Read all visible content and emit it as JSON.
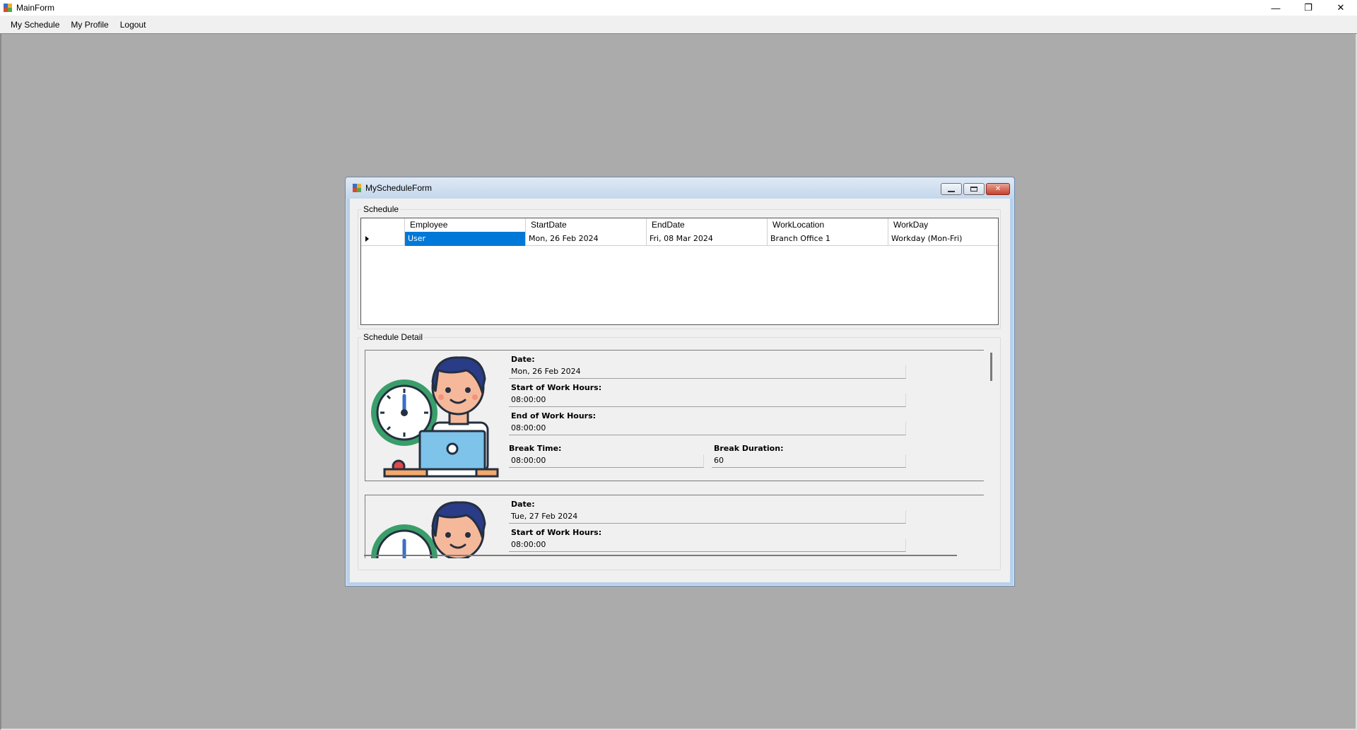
{
  "main_window": {
    "title": "MainForm",
    "controls": {
      "minimize": "—",
      "restore": "❐",
      "close": "✕"
    }
  },
  "menu": {
    "items": [
      {
        "label": "My Schedule"
      },
      {
        "label": "My Profile"
      },
      {
        "label": "Logout"
      }
    ]
  },
  "schedule_form": {
    "title": "MyScheduleForm",
    "schedule_group_label": "Schedule",
    "grid": {
      "columns": [
        "Employee",
        "StartDate",
        "EndDate",
        "WorkLocation",
        "WorkDay"
      ],
      "rows": [
        {
          "employee": "User",
          "start_date": "Mon, 26 Feb 2024",
          "end_date": "Fri, 08 Mar 2024",
          "work_location": "Branch Office 1",
          "work_day": "Workday (Mon-Fri)"
        }
      ]
    },
    "detail_group_label": "Schedule Detail",
    "details": [
      {
        "date_label": "Date:",
        "date": "Mon, 26 Feb 2024",
        "start_label": "Start of Work Hours:",
        "start": "08:00:00",
        "end_label": "End of Work Hours:",
        "end": "08:00:00",
        "break_time_label": "Break Time:",
        "break_time": "08:00:00",
        "break_duration_label": "Break Duration:",
        "break_duration": "60"
      },
      {
        "date_label": "Date:",
        "date": "Tue, 27 Feb 2024",
        "start_label": "Start of Work Hours:",
        "start": "08:00:00"
      }
    ]
  },
  "icons": {
    "app": "app-window-icon",
    "illustration": "employee-clock-laptop-illustration"
  },
  "colors": {
    "selection": "#0078d7",
    "mdi_background": "#ababab",
    "clock_green": "#3a9e6b",
    "laptop_blue": "#7ec3ea"
  }
}
